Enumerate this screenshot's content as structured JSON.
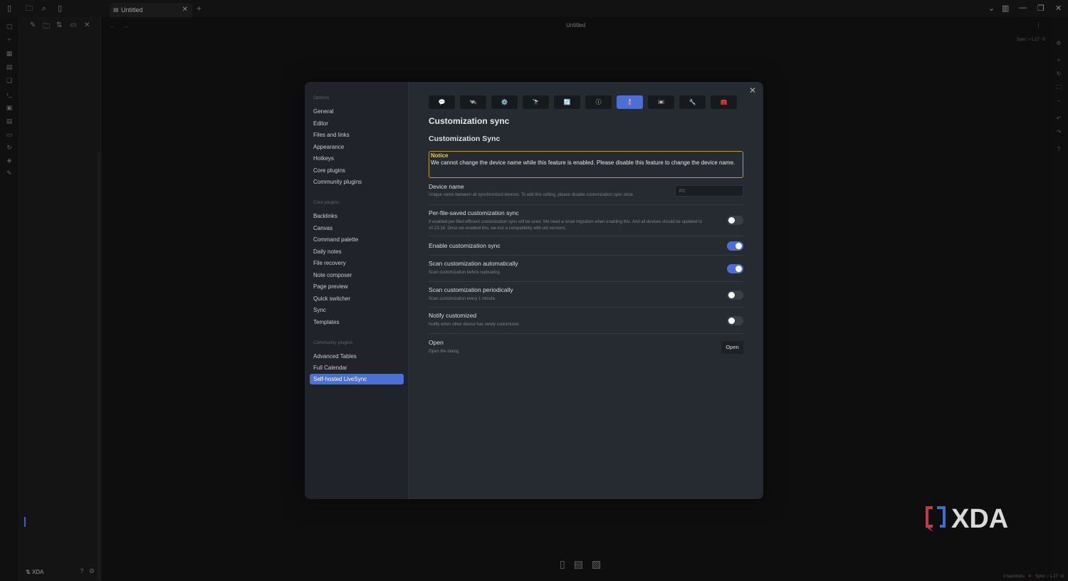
{
  "tab": {
    "title": "Untitled"
  },
  "workspace": {
    "title": "Untitled",
    "sync_tag": "Sync: ⸗ 1.27 ↑0"
  },
  "vault": {
    "name": "XDA"
  },
  "status": {
    "backlinks": "0 backlinks",
    "sync": "Sync: ⸗ 1.27 ↑0"
  },
  "settings": {
    "sidebar": {
      "options_heading": "Options",
      "options": [
        "General",
        "Editor",
        "Files and links",
        "Appearance",
        "Hotkeys",
        "Core plugins",
        "Community plugins"
      ],
      "core_heading": "Core plugins",
      "core": [
        "Backlinks",
        "Canvas",
        "Command palette",
        "Daily notes",
        "File recovery",
        "Note composer",
        "Page preview",
        "Quick switcher",
        "Sync",
        "Templates"
      ],
      "community_heading": "Community plugins",
      "community": [
        "Advanced Tables",
        "Full Calendar",
        "Self-hosted LiveSync"
      ],
      "active": "Self-hosted LiveSync"
    },
    "icon_tabs": [
      "💬",
      "🛰️",
      "⚙️",
      "🔭",
      "🔄",
      "ⓘ",
      "🌡️",
      "📼",
      "🔧",
      "🧰"
    ],
    "icon_tabs_active_index": 6,
    "page_title": "Customization sync",
    "section_title": "Customization Sync",
    "notice": {
      "title": "Notice",
      "text": "We cannot change the device name while this feature is enabled. Please disable this feature to change the device name."
    },
    "items": {
      "device_name": {
        "name": "Device name",
        "desc": "Unique name between all synchronized devices. To edit this setting, please disable customization sync once.",
        "placeholder": "PC"
      },
      "per_file": {
        "name": "Per-file-saved customization sync",
        "desc": "If enabled per-filed efficient customization sync will be used. We need a small migration when enabling this. And all devices should be updated to v0.23.18. Once we enabled this, we lost a compatibility with old versions.",
        "enabled": false
      },
      "enable_sync": {
        "name": "Enable customization sync",
        "enabled": true
      },
      "scan_auto": {
        "name": "Scan customization automatically",
        "desc": "Scan customization before replicating.",
        "enabled": true
      },
      "scan_periodic": {
        "name": "Scan customization periodically",
        "desc": "Scan customization every 1 minute.",
        "enabled": false
      },
      "notify": {
        "name": "Notify customized",
        "desc": "Notify when other device has newly customized.",
        "enabled": false
      },
      "open": {
        "name": "Open",
        "desc": "Open the dialog",
        "button": "Open"
      }
    }
  },
  "colors": {
    "accent": "#4a6fd6",
    "notice_border": "#b79c3c",
    "notice_title": "#f3c84b"
  },
  "watermark": {
    "text": "XDA"
  }
}
